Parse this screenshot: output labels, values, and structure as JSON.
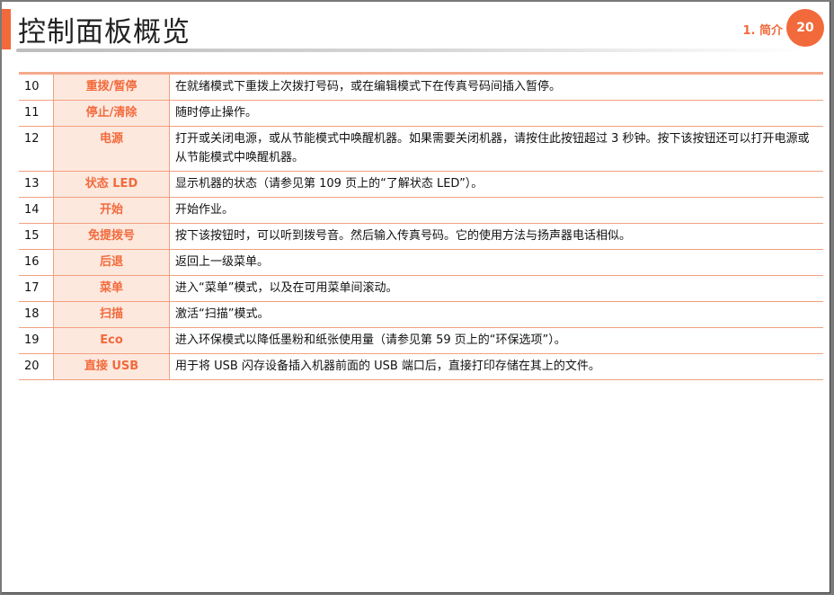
{
  "header": {
    "title": "控制面板概览",
    "chapter": "1. 简介",
    "page_number": "20"
  },
  "colors": {
    "accent": "#f26a3c",
    "name_cell_bg": "#fde8de",
    "rule": "#f1a080"
  },
  "rows": [
    {
      "num": "10",
      "name": "重拨/暂停",
      "desc": "在就绪模式下重拨上次拨打号码，或在编辑模式下在传真号码间插入暂停。"
    },
    {
      "num": "11",
      "name": "停止/清除",
      "desc": "随时停止操作。"
    },
    {
      "num": "12",
      "name": "电源",
      "desc": "打开或关闭电源，或从节能模式中唤醒机器。如果需要关闭机器，请按住此按钮超过 3 秒钟。按下该按钮还可以打开电源或从节能模式中唤醒机器。"
    },
    {
      "num": "13",
      "name": "状态 LED",
      "desc": "显示机器的状态（请参见第 109 页上的“了解状态 LED”）。"
    },
    {
      "num": "14",
      "name": "开始",
      "desc": "开始作业。"
    },
    {
      "num": "15",
      "name": "免提拨号",
      "desc": "按下该按钮时，可以听到拨号音。然后输入传真号码。它的使用方法与扬声器电话相似。"
    },
    {
      "num": "16",
      "name": "后退",
      "desc": "返回上一级菜单。"
    },
    {
      "num": "17",
      "name": "菜单",
      "desc": "进入“菜单”模式，以及在可用菜单间滚动。"
    },
    {
      "num": "18",
      "name": "扫描",
      "desc": "激活“扫描”模式。"
    },
    {
      "num": "19",
      "name": "Eco",
      "desc": "进入环保模式以降低墨粉和纸张使用量（请参见第 59 页上的“环保选项”）。"
    },
    {
      "num": "20",
      "name": "直接 USB",
      "desc": "用于将 USB 闪存设备插入机器前面的 USB 端口后，直接打印存储在其上的文件。"
    }
  ]
}
